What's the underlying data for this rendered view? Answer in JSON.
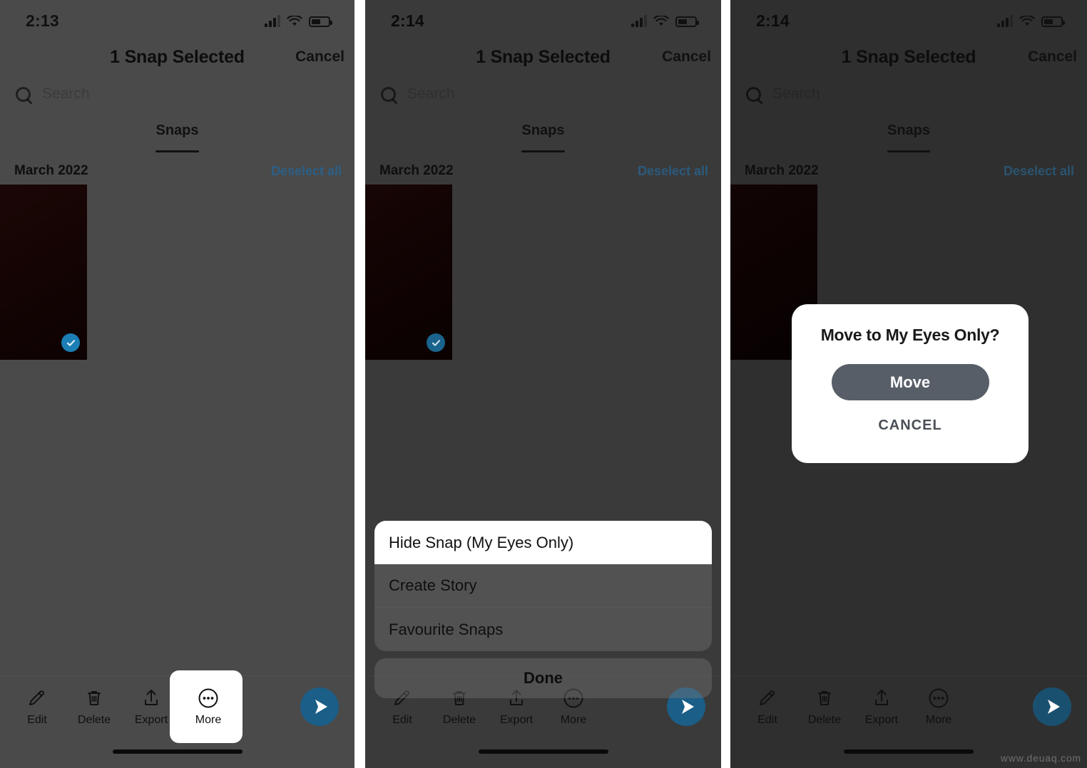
{
  "watermark": "www.deuaq.com",
  "panels": [
    {
      "id": "panel-select-snap",
      "status": {
        "time": "2:13",
        "signal_icon": "cellular-signal-icon",
        "wifi_icon": "wifi-icon",
        "battery_icon": "battery-icon"
      },
      "nav": {
        "title": "1 Snap Selected",
        "cancel": "Cancel"
      },
      "search": {
        "placeholder": "Search",
        "icon": "search-icon"
      },
      "tabs": [
        {
          "label": "Snaps",
          "active": true
        }
      ],
      "month": {
        "label": "March 2022",
        "deselect": "Deselect all"
      },
      "toolbar": {
        "items": [
          {
            "label": "Edit",
            "icon": "pencil-icon"
          },
          {
            "label": "Delete",
            "icon": "trash-icon"
          },
          {
            "label": "Export",
            "icon": "upload-icon"
          },
          {
            "label": "More",
            "icon": "ellipsis-circle-icon"
          }
        ],
        "send_icon": "send-arrow-icon",
        "highlighted": "More"
      }
    },
    {
      "id": "panel-action-sheet",
      "status": {
        "time": "2:14",
        "signal_icon": "cellular-signal-icon",
        "wifi_icon": "wifi-icon",
        "battery_icon": "battery-icon"
      },
      "nav": {
        "title": "1 Snap Selected",
        "cancel": "Cancel"
      },
      "search": {
        "placeholder": "Search",
        "icon": "search-icon"
      },
      "tabs": [
        {
          "label": "Snaps",
          "active": true
        }
      ],
      "month": {
        "label": "March 2022",
        "deselect": "Deselect all"
      },
      "sheet": {
        "items": [
          {
            "label": "Hide Snap (My Eyes Only)",
            "highlighted": true
          },
          {
            "label": "Create Story",
            "highlighted": false
          },
          {
            "label": "Favourite Snaps",
            "highlighted": false
          }
        ],
        "done": "Done"
      },
      "toolbar": {
        "items": [
          {
            "label": "Edit",
            "icon": "pencil-icon"
          },
          {
            "label": "Delete",
            "icon": "trash-icon"
          },
          {
            "label": "Export",
            "icon": "upload-icon"
          },
          {
            "label": "More",
            "icon": "ellipsis-circle-icon"
          }
        ],
        "send_icon": "send-arrow-icon"
      }
    },
    {
      "id": "panel-confirm-dialog",
      "status": {
        "time": "2:14",
        "signal_icon": "cellular-signal-icon",
        "wifi_icon": "wifi-icon",
        "battery_icon": "battery-icon"
      },
      "nav": {
        "title": "1 Snap Selected",
        "cancel": "Cancel"
      },
      "search": {
        "placeholder": "Search",
        "icon": "search-icon"
      },
      "tabs": [
        {
          "label": "Snaps",
          "active": true
        }
      ],
      "month": {
        "label": "March 2022",
        "deselect": "Deselect all"
      },
      "dialog": {
        "title": "Move to My Eyes Only?",
        "confirm": "Move",
        "cancel": "CANCEL"
      },
      "toolbar": {
        "items": [
          {
            "label": "Edit",
            "icon": "pencil-icon"
          },
          {
            "label": "Delete",
            "icon": "trash-icon"
          },
          {
            "label": "Export",
            "icon": "upload-icon"
          },
          {
            "label": "More",
            "icon": "ellipsis-circle-icon"
          }
        ],
        "send_icon": "send-arrow-icon"
      }
    }
  ],
  "colors": {
    "accent_blue": "#1b7fb5",
    "link_blue": "#2c5f86",
    "dialog_button": "#575e68",
    "screen_bg": "#303030"
  }
}
